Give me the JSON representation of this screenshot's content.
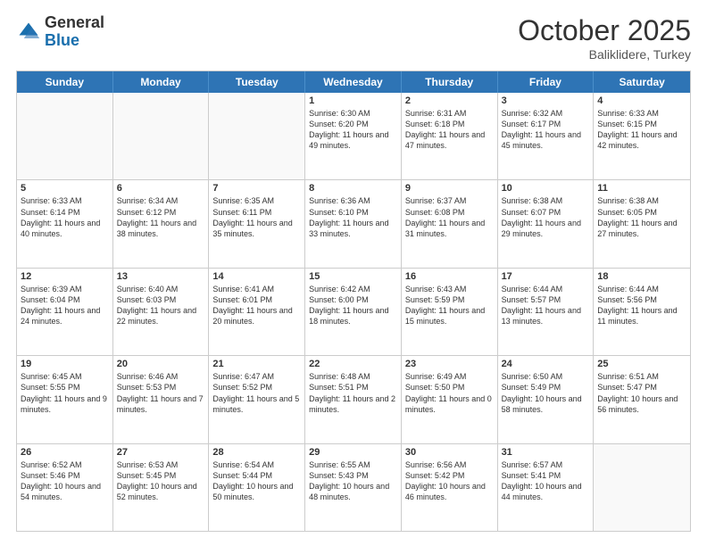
{
  "header": {
    "logo": {
      "line1": "General",
      "line2": "Blue"
    },
    "title": "October 2025",
    "location": "Baliklidere, Turkey"
  },
  "days_of_week": [
    "Sunday",
    "Monday",
    "Tuesday",
    "Wednesday",
    "Thursday",
    "Friday",
    "Saturday"
  ],
  "weeks": [
    [
      {
        "day": "",
        "info": ""
      },
      {
        "day": "",
        "info": ""
      },
      {
        "day": "",
        "info": ""
      },
      {
        "day": "1",
        "info": "Sunrise: 6:30 AM\nSunset: 6:20 PM\nDaylight: 11 hours\nand 49 minutes."
      },
      {
        "day": "2",
        "info": "Sunrise: 6:31 AM\nSunset: 6:18 PM\nDaylight: 11 hours\nand 47 minutes."
      },
      {
        "day": "3",
        "info": "Sunrise: 6:32 AM\nSunset: 6:17 PM\nDaylight: 11 hours\nand 45 minutes."
      },
      {
        "day": "4",
        "info": "Sunrise: 6:33 AM\nSunset: 6:15 PM\nDaylight: 11 hours\nand 42 minutes."
      }
    ],
    [
      {
        "day": "5",
        "info": "Sunrise: 6:33 AM\nSunset: 6:14 PM\nDaylight: 11 hours\nand 40 minutes."
      },
      {
        "day": "6",
        "info": "Sunrise: 6:34 AM\nSunset: 6:12 PM\nDaylight: 11 hours\nand 38 minutes."
      },
      {
        "day": "7",
        "info": "Sunrise: 6:35 AM\nSunset: 6:11 PM\nDaylight: 11 hours\nand 35 minutes."
      },
      {
        "day": "8",
        "info": "Sunrise: 6:36 AM\nSunset: 6:10 PM\nDaylight: 11 hours\nand 33 minutes."
      },
      {
        "day": "9",
        "info": "Sunrise: 6:37 AM\nSunset: 6:08 PM\nDaylight: 11 hours\nand 31 minutes."
      },
      {
        "day": "10",
        "info": "Sunrise: 6:38 AM\nSunset: 6:07 PM\nDaylight: 11 hours\nand 29 minutes."
      },
      {
        "day": "11",
        "info": "Sunrise: 6:38 AM\nSunset: 6:05 PM\nDaylight: 11 hours\nand 27 minutes."
      }
    ],
    [
      {
        "day": "12",
        "info": "Sunrise: 6:39 AM\nSunset: 6:04 PM\nDaylight: 11 hours\nand 24 minutes."
      },
      {
        "day": "13",
        "info": "Sunrise: 6:40 AM\nSunset: 6:03 PM\nDaylight: 11 hours\nand 22 minutes."
      },
      {
        "day": "14",
        "info": "Sunrise: 6:41 AM\nSunset: 6:01 PM\nDaylight: 11 hours\nand 20 minutes."
      },
      {
        "day": "15",
        "info": "Sunrise: 6:42 AM\nSunset: 6:00 PM\nDaylight: 11 hours\nand 18 minutes."
      },
      {
        "day": "16",
        "info": "Sunrise: 6:43 AM\nSunset: 5:59 PM\nDaylight: 11 hours\nand 15 minutes."
      },
      {
        "day": "17",
        "info": "Sunrise: 6:44 AM\nSunset: 5:57 PM\nDaylight: 11 hours\nand 13 minutes."
      },
      {
        "day": "18",
        "info": "Sunrise: 6:44 AM\nSunset: 5:56 PM\nDaylight: 11 hours\nand 11 minutes."
      }
    ],
    [
      {
        "day": "19",
        "info": "Sunrise: 6:45 AM\nSunset: 5:55 PM\nDaylight: 11 hours\nand 9 minutes."
      },
      {
        "day": "20",
        "info": "Sunrise: 6:46 AM\nSunset: 5:53 PM\nDaylight: 11 hours\nand 7 minutes."
      },
      {
        "day": "21",
        "info": "Sunrise: 6:47 AM\nSunset: 5:52 PM\nDaylight: 11 hours\nand 5 minutes."
      },
      {
        "day": "22",
        "info": "Sunrise: 6:48 AM\nSunset: 5:51 PM\nDaylight: 11 hours\nand 2 minutes."
      },
      {
        "day": "23",
        "info": "Sunrise: 6:49 AM\nSunset: 5:50 PM\nDaylight: 11 hours\nand 0 minutes."
      },
      {
        "day": "24",
        "info": "Sunrise: 6:50 AM\nSunset: 5:49 PM\nDaylight: 10 hours\nand 58 minutes."
      },
      {
        "day": "25",
        "info": "Sunrise: 6:51 AM\nSunset: 5:47 PM\nDaylight: 10 hours\nand 56 minutes."
      }
    ],
    [
      {
        "day": "26",
        "info": "Sunrise: 6:52 AM\nSunset: 5:46 PM\nDaylight: 10 hours\nand 54 minutes."
      },
      {
        "day": "27",
        "info": "Sunrise: 6:53 AM\nSunset: 5:45 PM\nDaylight: 10 hours\nand 52 minutes."
      },
      {
        "day": "28",
        "info": "Sunrise: 6:54 AM\nSunset: 5:44 PM\nDaylight: 10 hours\nand 50 minutes."
      },
      {
        "day": "29",
        "info": "Sunrise: 6:55 AM\nSunset: 5:43 PM\nDaylight: 10 hours\nand 48 minutes."
      },
      {
        "day": "30",
        "info": "Sunrise: 6:56 AM\nSunset: 5:42 PM\nDaylight: 10 hours\nand 46 minutes."
      },
      {
        "day": "31",
        "info": "Sunrise: 6:57 AM\nSunset: 5:41 PM\nDaylight: 10 hours\nand 44 minutes."
      },
      {
        "day": "",
        "info": ""
      }
    ]
  ]
}
